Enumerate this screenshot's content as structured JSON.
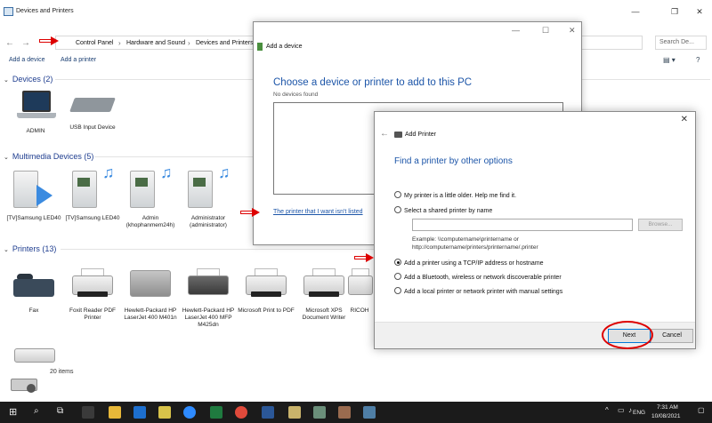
{
  "window": {
    "title": "Devices and Printers",
    "controls": [
      "—",
      "❐",
      "✕"
    ]
  },
  "nav": {
    "back": "←",
    "forward": "→",
    "breadcrumbs": [
      "Control Panel",
      "Hardware and Sound",
      "Devices and Printers"
    ],
    "search_placeholder": "Search De..."
  },
  "commands": {
    "add_device": "Add a device",
    "add_printer": "Add a printer",
    "view_icon": "view-options-icon"
  },
  "sections": {
    "devices": {
      "header": "Devices (2)",
      "items": [
        {
          "label": "ADMIN",
          "icon": "laptop-icon"
        },
        {
          "label": "USB Input Device",
          "icon": "keyboard-icon"
        }
      ]
    },
    "multimedia": {
      "header": "Multimedia Devices (5)",
      "items": [
        {
          "label": "[TV]Samsung LED40",
          "icon": "media-device-icon"
        },
        {
          "label": "[TV]Samsung LED40",
          "icon": "media-device-icon"
        },
        {
          "label": "Admin (khophanmem24h)",
          "icon": "media-device-icon"
        },
        {
          "label": "Administrator (administrator)",
          "icon": "media-device-icon"
        }
      ]
    },
    "printers": {
      "header": "Printers (13)",
      "items": [
        {
          "label": "Fax",
          "icon": "fax-icon"
        },
        {
          "label": "Foxit Reader PDF Printer",
          "icon": "printer-icon"
        },
        {
          "label": "Hewlett-Packard HP LaserJet 400 M401n",
          "icon": "printer-icon"
        },
        {
          "label": "Hewlett-Packard HP LaserJet 400 MFP M425dn",
          "icon": "mfp-printer-icon"
        },
        {
          "label": "Microsoft Print to PDF",
          "icon": "printer-icon"
        },
        {
          "label": "Microsoft XPS Document Writer",
          "icon": "printer-icon"
        },
        {
          "label": "RICOH",
          "icon": "printer-icon"
        }
      ]
    }
  },
  "status": {
    "count": "20 items"
  },
  "add_device_dialog": {
    "title": "Add a device",
    "heading": "Choose a device or printer to add to this PC",
    "subtext": "No devices found",
    "link": "The printer that I want isn't listed"
  },
  "add_printer_dialog": {
    "title": "Add Printer",
    "heading": "Find a printer by other options",
    "options": [
      {
        "label": "My printer is a little older. Help me find it.",
        "selected": false
      },
      {
        "label": "Select a shared printer by name",
        "selected": false
      },
      {
        "label": "Add a printer using a TCP/IP address or hostname",
        "selected": true
      },
      {
        "label": "Add a Bluetooth, wireless or network discoverable printer",
        "selected": false
      },
      {
        "label": "Add a local printer or network printer with manual settings",
        "selected": false
      }
    ],
    "browse_label": "Browse...",
    "example_text": "Example: \\\\computername\\printername or http://computername/printers/printername/.printer",
    "next_label": "Next",
    "cancel_label": "Cancel"
  },
  "taskbar": {
    "language": "ENG",
    "time": "7:31 AM",
    "date": "10/08/2021"
  },
  "colors": {
    "accent_blue": "#1c55a8",
    "annotation_red": "#dd0000",
    "taskbar": "#1b1b1b"
  }
}
